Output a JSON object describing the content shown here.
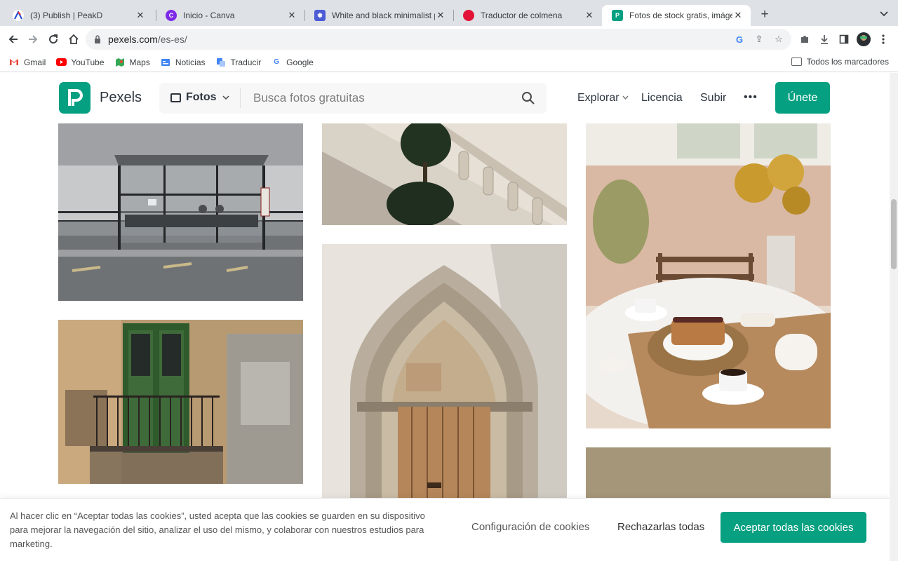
{
  "browser": {
    "tabs": [
      {
        "title": "(3) Publish | PeakD",
        "icon": "peakd-icon"
      },
      {
        "title": "Inicio - Canva",
        "icon": "canva-icon"
      },
      {
        "title": "White and black minimalist pro",
        "icon": "canva-design-icon"
      },
      {
        "title": "Traductor de colmena",
        "icon": "hive-icon"
      },
      {
        "title": "Fotos de stock gratis, imágenes",
        "icon": "pexels-icon",
        "active": true
      }
    ],
    "url_domain": "pexels.com",
    "url_path": "/es-es/",
    "bookmarks": [
      {
        "label": "Gmail",
        "icon": "gmail-icon"
      },
      {
        "label": "YouTube",
        "icon": "youtube-icon"
      },
      {
        "label": "Maps",
        "icon": "maps-icon"
      },
      {
        "label": "Noticias",
        "icon": "news-icon"
      },
      {
        "label": "Traducir",
        "icon": "translate-icon"
      },
      {
        "label": "Google",
        "icon": "google-icon"
      }
    ],
    "all_bookmarks": "Todos los marcadores"
  },
  "site": {
    "logo_letter": "P",
    "name": "Pexels",
    "search_type": "Fotos",
    "search_placeholder": "Busca fotos gratuitas",
    "nav": {
      "explore": "Explorar",
      "license": "Licencia",
      "upload": "Subir"
    },
    "join": "Únete"
  },
  "photos": [
    {
      "subject": "bus-shelter"
    },
    {
      "subject": "stone-staircase"
    },
    {
      "subject": "breakfast-table"
    },
    {
      "subject": "green-balcony-door"
    },
    {
      "subject": "gothic-arch-door"
    },
    {
      "subject": "beige-wall"
    }
  ],
  "cookie": {
    "message": "Al hacer clic en “Aceptar todas las cookies”, usted acepta que las cookies se guarden en su dispositivo para mejorar la navegación del sitio, analizar el uso del mismo, y colaborar con nuestros estudios para marketing.",
    "settings": "Configuración de cookies",
    "reject": "Rechazarlas todas",
    "accept": "Aceptar todas las cookies"
  },
  "colors": {
    "brand": "#05a081",
    "chrome_bg": "#dee1e6"
  }
}
